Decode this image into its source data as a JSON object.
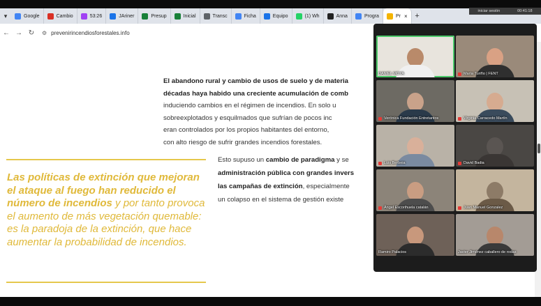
{
  "tabs": [
    {
      "label": "Google",
      "color": "#4285f4"
    },
    {
      "label": "Cambio",
      "color": "#d93025"
    },
    {
      "label": "53:26",
      "color": "#a142f4"
    },
    {
      "label": "JAriner",
      "color": "#1a73e8"
    },
    {
      "label": "Presup",
      "color": "#188038"
    },
    {
      "label": "Inicial",
      "color": "#188038"
    },
    {
      "label": "Transc",
      "color": "#5f6368"
    },
    {
      "label": "Ficha",
      "color": "#4285f4"
    },
    {
      "label": "Equipo",
      "color": "#1a73e8"
    },
    {
      "label": "(1) Wh",
      "color": "#25d366"
    },
    {
      "label": "Anna",
      "color": "#222222"
    },
    {
      "label": "Progra",
      "color": "#4285f4"
    },
    {
      "label": "Pr",
      "color": "#f4b400"
    }
  ],
  "address": {
    "url": "prevenirincendiosforestales.info"
  },
  "meet_bar": {
    "left": "iniciar sesión",
    "time": "00:41:18"
  },
  "article": {
    "p1": [
      {
        "text": "El abandono rural y cambio de usos de suelo y de materia",
        "bold": true
      },
      {
        "text": "décadas haya habido una creciente acumulación de comb",
        "bold": true
      },
      {
        "text": "induciendo cambios en el régimen de incendios. En solo u",
        "bold": false
      },
      {
        "text": "sobreexplotados y esquilmados que sufrían de pocos inc",
        "bold": false
      },
      {
        "text": "eran controlados por los propios habitantes del entorno, ",
        "bold": false
      },
      {
        "text": "con alto riesgo de sufrir grandes incendios forestales.",
        "bold": false
      }
    ],
    "p2": {
      "l1a": "Esto supuso un ",
      "l1b": "cambio de paradigma",
      "l1c": " y se",
      "l2": "administración pública con grandes invers",
      "l3a": "las campañas de extinción",
      "l3b": ", especialmente",
      "l4": "un colapso en el sistema de gestión existe"
    },
    "quote": {
      "bold_part": "Las políticas de extinción que mejoran el ataque al fuego han reducido el número de incendios",
      "rest": " y por tanto provoca el aumento de más vegetación quemable: es la paradoja de la extinción, que hace aumentar la probabilidad de incendios."
    }
  },
  "participants": [
    {
      "name": "DANIEL MOYA",
      "bg": "#e8e4dd",
      "skin": "#b98a6a",
      "shirt": "#f0f0f0",
      "muted": false,
      "speaking": true
    },
    {
      "name": "María Turiño | FENT",
      "bg": "#9a8a7a",
      "skin": "#d9a184",
      "shirt": "#2f2f2f",
      "muted": true,
      "speaking": false
    },
    {
      "name": "Verónica Fundación Entretantos",
      "bg": "#6d6a63",
      "skin": "#c9a28a",
      "shirt": "#2a3a4a",
      "muted": true,
      "speaking": false
    },
    {
      "name": "Virginia Carracedo Martín",
      "bg": "#c7c1b5",
      "skin": "#d6ab90",
      "shirt": "#3a4b5c",
      "muted": true,
      "speaking": false
    },
    {
      "name": "Luis Berbeia",
      "bg": "#b9b2a7",
      "skin": "#d9b09a",
      "shirt": "#7a8aa0",
      "muted": true,
      "speaking": false
    },
    {
      "name": "David Badia",
      "bg": "#4a4744",
      "skin": "#5a5552",
      "shirt": "#3a3634",
      "muted": true,
      "speaking": false
    },
    {
      "name": "Ángel Escorihuela catalán",
      "bg": "#8c8479",
      "skin": "#c99d82",
      "shirt": "#4d4d4d",
      "muted": true,
      "speaking": false
    },
    {
      "name": "Juan Manuel Gonzalez",
      "bg": "#c4b59e",
      "skin": "#8d7b67",
      "shirt": "#6b5a47",
      "muted": true,
      "speaking": false
    },
    {
      "name": "Ramiro Palacios",
      "bg": "#6e6158",
      "skin": "#c8987c",
      "shirt": "#2c2c2c",
      "muted": false,
      "speaking": false
    },
    {
      "name": "Javier Jiménez caballero de rodas",
      "bg": "#a39c95",
      "skin": "#b8876b",
      "shirt": "#3a3a3a",
      "muted": false,
      "speaking": false
    }
  ]
}
